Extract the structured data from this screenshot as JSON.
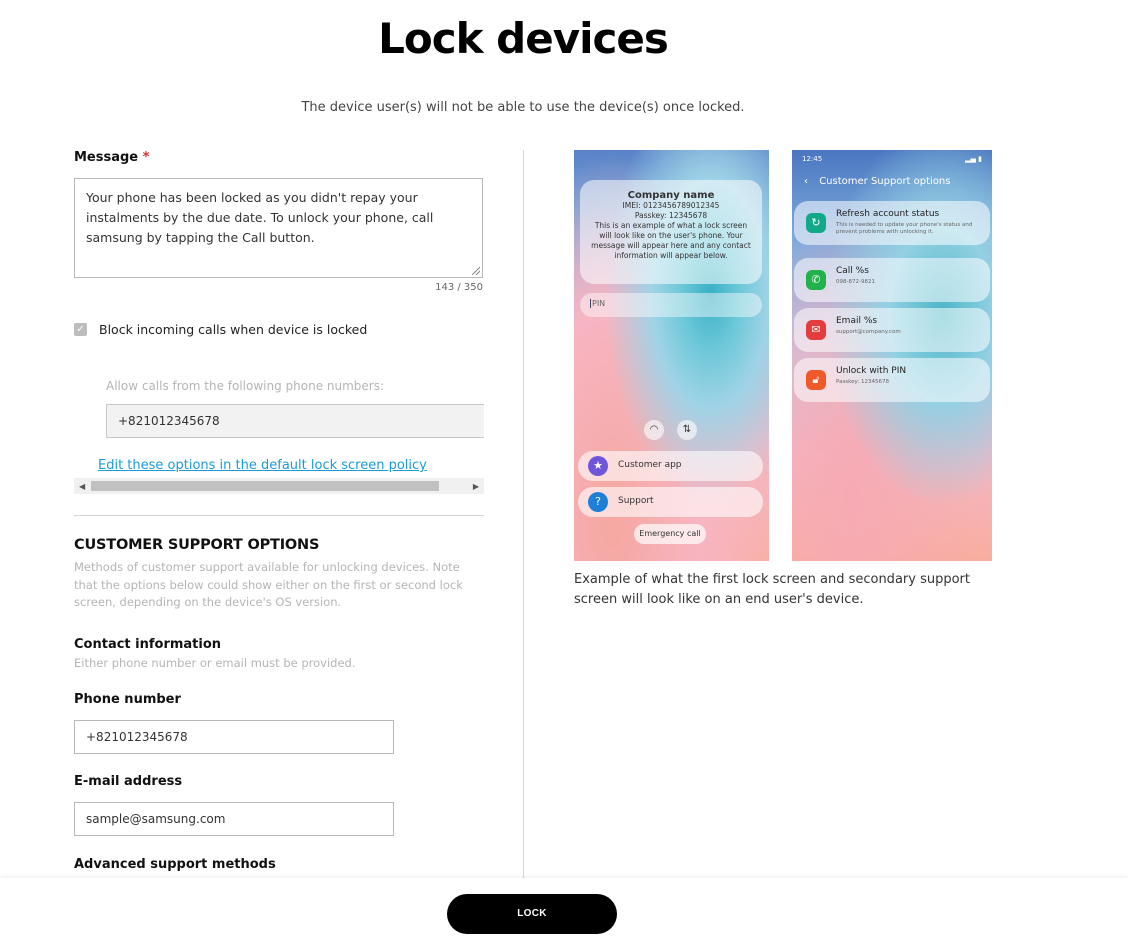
{
  "page": {
    "title": "Lock devices",
    "subtitle": "The device user(s) will not be able to use the device(s) once locked."
  },
  "message": {
    "label": "Message",
    "required_mark": "*",
    "value": "Your phone has been locked as you didn't repay your instalments by the due date. To unlock your phone, call samsung by tapping the Call button.",
    "counter": "143 / 350"
  },
  "block_calls": {
    "checked": true,
    "label": "Block incoming calls when device is locked",
    "allow_label": "Allow calls from the following phone numbers:",
    "allow_value": "+821012345678",
    "edit_link": "Edit these options in the default lock screen policy"
  },
  "support": {
    "title": "CUSTOMER SUPPORT OPTIONS",
    "description": "Methods of customer support available for unlocking devices. Note that the options below could show either on the first or second lock screen, depending on the device's OS version.",
    "contact_title": "Contact information",
    "contact_desc": "Either phone number or email must be provided.",
    "phone_label": "Phone number",
    "phone_value": "+821012345678",
    "email_label": "E-mail address",
    "email_value": "sample@samsung.com",
    "advanced_label": "Advanced support methods"
  },
  "preview": {
    "lock_screen": {
      "company": "Company name",
      "imei": "IMEI: 0123456789012345",
      "passkey": "Passkey: 12345678",
      "msg1": "This is an example of what a lock screen",
      "msg2": "will look like on the user's phone. Your",
      "msg3": "message will appear here and any contact",
      "msg4": "information will appear below.",
      "pin_placeholder": "PIN",
      "customer_app": "Customer app",
      "support": "Support",
      "emergency": "Emergency call"
    },
    "support_screen": {
      "time": "12:45",
      "header": "Customer Support options",
      "items": [
        {
          "title": "Refresh account status",
          "sub": "This is needed to update your phone's status and prevent problems with unlocking it."
        },
        {
          "title": "Call %s",
          "sub": "098-872-9821"
        },
        {
          "title": "Email %s",
          "sub": "support@company.com"
        },
        {
          "title": "Unlock with PIN",
          "sub": "Passkey: 12345678"
        }
      ]
    },
    "caption": "Example of what the first lock screen and secondary support screen will look like on an end user's device."
  },
  "footer": {
    "lock_label": "LOCK"
  },
  "colors": {
    "accent_link": "#1a9bd7",
    "required": "#d32f2f",
    "primary_button": "#000000"
  }
}
